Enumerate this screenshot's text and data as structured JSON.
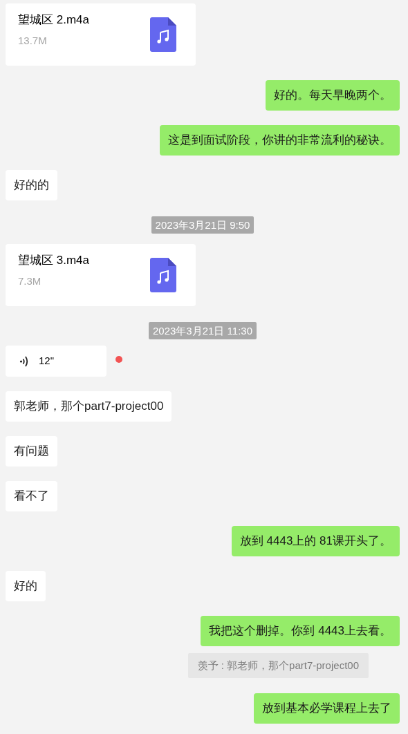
{
  "messages": [
    {
      "kind": "file",
      "outgoing": false,
      "name": "望城区 2.m4a",
      "size": "13.7M"
    },
    {
      "kind": "text",
      "outgoing": true,
      "text": "好的。每天早晚两个。"
    },
    {
      "kind": "text",
      "outgoing": true,
      "text": "这是到面试阶段，你讲的非常流利的秘诀。"
    },
    {
      "kind": "text",
      "outgoing": false,
      "text": "好的的"
    },
    {
      "kind": "time",
      "text": "2023年3月21日 9:50"
    },
    {
      "kind": "file",
      "outgoing": false,
      "name": "望城区 3.m4a",
      "size": "7.3M"
    },
    {
      "kind": "time",
      "text": "2023年3月21日 11:30"
    },
    {
      "kind": "voice",
      "outgoing": false,
      "duration": "12\"",
      "unread": true
    },
    {
      "kind": "text",
      "outgoing": false,
      "text": "郭老师，那个part7-project00"
    },
    {
      "kind": "text",
      "outgoing": false,
      "text": "有问题"
    },
    {
      "kind": "text",
      "outgoing": false,
      "text": "看不了"
    },
    {
      "kind": "text",
      "outgoing": true,
      "text": "放到 4443上的 81课开头了。"
    },
    {
      "kind": "text",
      "outgoing": false,
      "text": "好的"
    },
    {
      "kind": "text",
      "outgoing": true,
      "text": "我把这个删掉。你到 4443上去看。"
    },
    {
      "kind": "quote",
      "outgoing": true,
      "text": "羡予 : 郭老师，那个part7-project00"
    },
    {
      "kind": "text",
      "outgoing": true,
      "text": "放到基本必学课程上去了"
    }
  ]
}
